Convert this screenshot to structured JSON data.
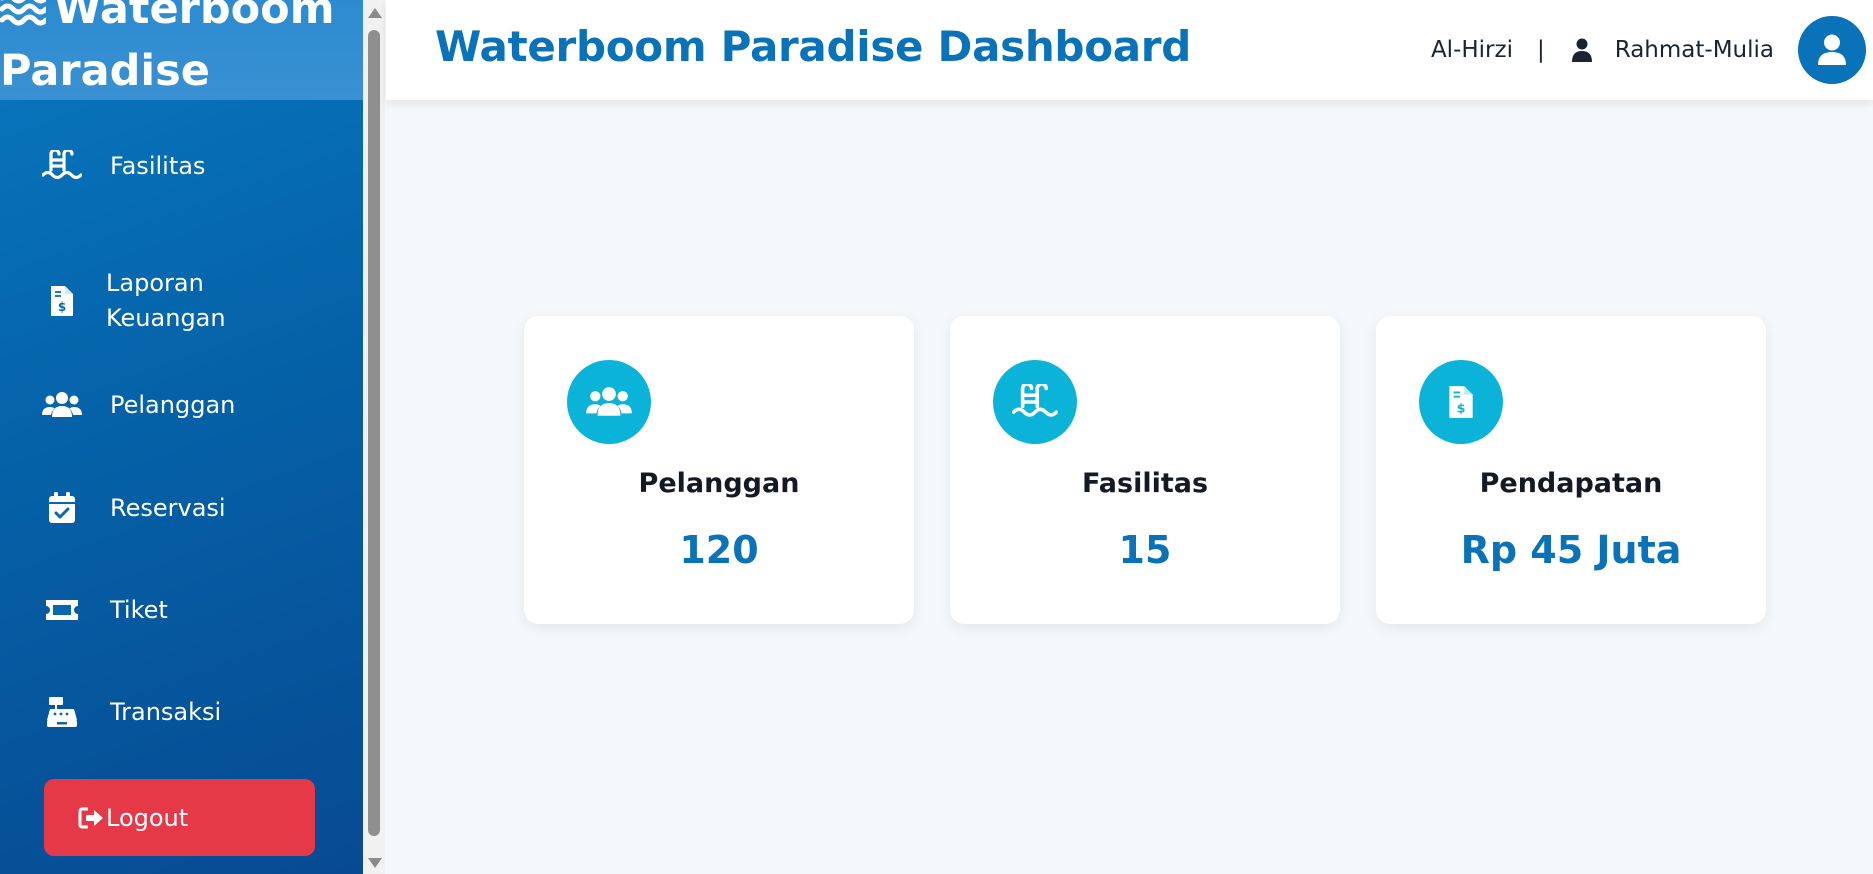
{
  "sidebar": {
    "brand": "Waterboom Paradise",
    "items": [
      {
        "label": "Fasilitas",
        "icon": "swimming-pool-icon"
      },
      {
        "label": "Laporan\nKeuangan",
        "icon": "invoice-dollar-icon"
      },
      {
        "label": "Pelanggan",
        "icon": "users-icon"
      },
      {
        "label": "Reservasi",
        "icon": "calendar-check-icon"
      },
      {
        "label": "Tiket",
        "icon": "ticket-icon"
      },
      {
        "label": "Transaksi",
        "icon": "cash-register-icon"
      }
    ],
    "logout_label": "Logout"
  },
  "header": {
    "title": "Waterboom Paradise Dashboard",
    "user_first": "Al-Hirzi",
    "separator": "|",
    "user_last": "Rahmat-Mulia"
  },
  "cards": [
    {
      "title": "Pelanggan",
      "value": "120",
      "icon": "users-icon"
    },
    {
      "title": "Fasilitas",
      "value": "15",
      "icon": "swimming-pool-icon"
    },
    {
      "title": "Pendapatan",
      "value": "Rp 45 Juta",
      "icon": "invoice-dollar-icon"
    }
  ],
  "colors": {
    "primary": "#0a72b8",
    "accent": "#0bb3d9",
    "danger": "#e63947",
    "sidebar_top": "#0878c0",
    "sidebar_bottom": "#074a92"
  }
}
